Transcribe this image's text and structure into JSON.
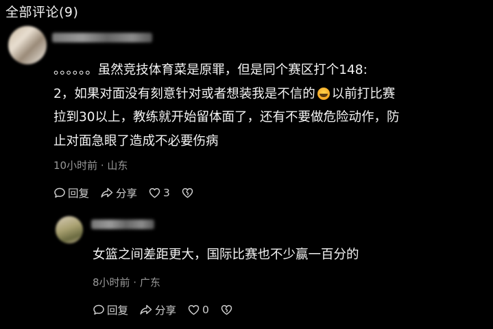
{
  "header": {
    "title": "全部评论(9)"
  },
  "comment": {
    "text_before_emoji": "。。。。。。虽然竞技体育菜是原罪，但是同个赛区打个148:\n2，如果对面没有刻意针对或者想装我是不信的",
    "emoji_icon": "laughing-emoji-icon",
    "text_after_emoji": "以前打比赛\n拉到30以上，教练就开始留体面了，还有不要做危险动作，防\n止对面急眼了造成不必要伤病",
    "meta": "10小时前 · 山东",
    "actions": {
      "reply": "回复",
      "share": "分享",
      "like_count": "3"
    }
  },
  "reply": {
    "text": "女篮之间差距更大，国际比赛也不少赢一百分的",
    "meta": "8小时前 · 广东",
    "actions": {
      "reply": "回复",
      "share": "分享",
      "like_count": "0"
    }
  }
}
